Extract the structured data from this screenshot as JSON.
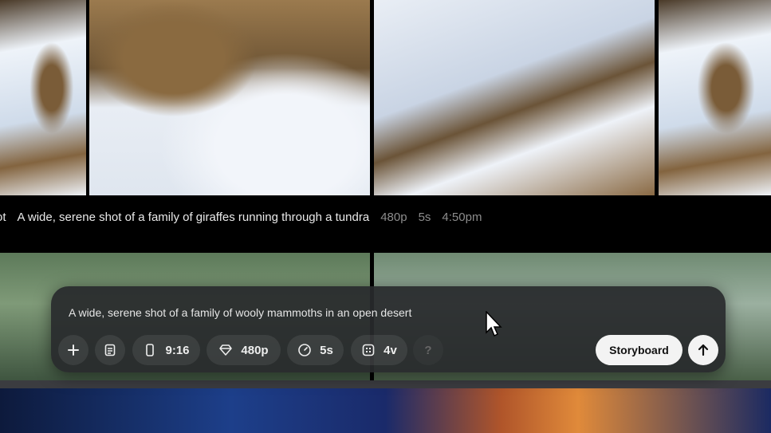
{
  "feed": {
    "caption": {
      "prefix": "ot",
      "prompt": "A wide, serene shot of a family of giraffes running through a tundra",
      "resolution": "480p",
      "duration": "5s",
      "time": "4:50pm"
    }
  },
  "composer": {
    "prompt_text": "A wide, serene shot of a family of wooly mammoths in an open desert",
    "add_icon": "plus-icon",
    "preset_icon": "settings-card-icon",
    "aspect_ratio": "9:16",
    "resolution": "480p",
    "duration": "5s",
    "variations": "4v",
    "help": "?",
    "storyboard_label": "Storyboard",
    "submit_icon": "arrow-up-icon"
  }
}
